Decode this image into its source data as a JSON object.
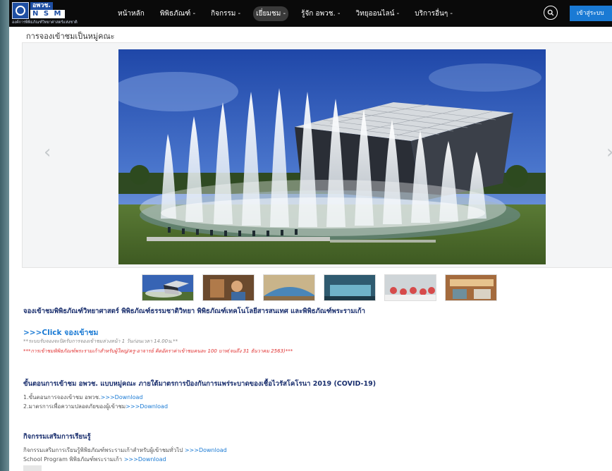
{
  "logo": {
    "top": "อพวช.",
    "nsm": "N S M",
    "sub": "องค์การพิพิธภัณฑ์วิทยาศาสตร์แห่งชาติ"
  },
  "nav": {
    "items": [
      {
        "label": "หน้าหลัก"
      },
      {
        "label": "พิพิธภัณฑ์ -"
      },
      {
        "label": "กิจกรรม -"
      },
      {
        "label": "เยี่ยมชม -",
        "active": true
      },
      {
        "label": "รู้จัก อพวช. -"
      },
      {
        "label": "วิทยุออนไลน์ -"
      },
      {
        "label": "บริการอื่นๆ -"
      }
    ],
    "search_icon": "search-icon",
    "login_label": "เข้าสู่ระบบ"
  },
  "page_heading": "การจองเข้าชมเป็นหมู่คณะ",
  "carousel": {
    "prev": "‹",
    "next": "›"
  },
  "thumbnails": [
    {
      "name": "thumb-fountain-building"
    },
    {
      "name": "thumb-exhibit-interior"
    },
    {
      "name": "thumb-dome-hall"
    },
    {
      "name": "thumb-gallery-room"
    },
    {
      "name": "thumb-student-group"
    },
    {
      "name": "thumb-exhibition-space"
    }
  ],
  "intro": {
    "title": "จองเข้าชมพิพิธภัณฑ์วิทยาศาสตร์ พิพิธภัณฑ์ธรรมชาติวิทยา พิพิธภัณฑ์เทคโนโลยีสารสนเทศ และพิพิธภัณฑ์พระรามเก้า",
    "click": ">>>Click จองเข้าชม",
    "note1": "**ระบบรับจองจะปิดรับการจองเข้าชมล่วงหน้า 1 วันก่อนเวลา 14.00น.**",
    "note2": "***การเข้าชมพิพิธภัณฑ์พระรามเก้าสำหรับผู้ใหญ่/ครู-อาจารย์ คิดอัตราค่าเข้าชมคนละ 100 บาท(จนถึง 31 ธันวาคม 2563)***"
  },
  "steps": {
    "title": "ขั้นตอนการเข้าชม อพวช. แบบหมู่คณะ ภายใต้มาตรการป้องกันการแพร่ระบาดของเชื้อไวรัสโคโรนา 2019 (COVID-19)",
    "line1_text": "1.ขั้นตอนการจองเข้าชม อพวช.",
    "line1_link": ">>>Download",
    "line2_text": "2.มาตรการเพื่อความปลอดภัยของผู้เข้าชม",
    "line2_link": ">>>Download"
  },
  "activities": {
    "title": "กิจกรรมเสริมการเรียนรู้",
    "line1_text": "กิจกรรมเสริมการเรียนรู้พิพิธภัณฑ์พระรามเก้าสำหรับผู้เข้าชมทั่วไป",
    "line1_link": ">>>Download",
    "line2_text": "School Program พิพิธภัณฑ์พระรามเก้า",
    "line2_link": ">>>Download"
  },
  "colors": {
    "accent": "#1a7ad4",
    "title": "#1a2f6e",
    "warning": "#e03030",
    "nav_bg": "#0a0a0a"
  }
}
